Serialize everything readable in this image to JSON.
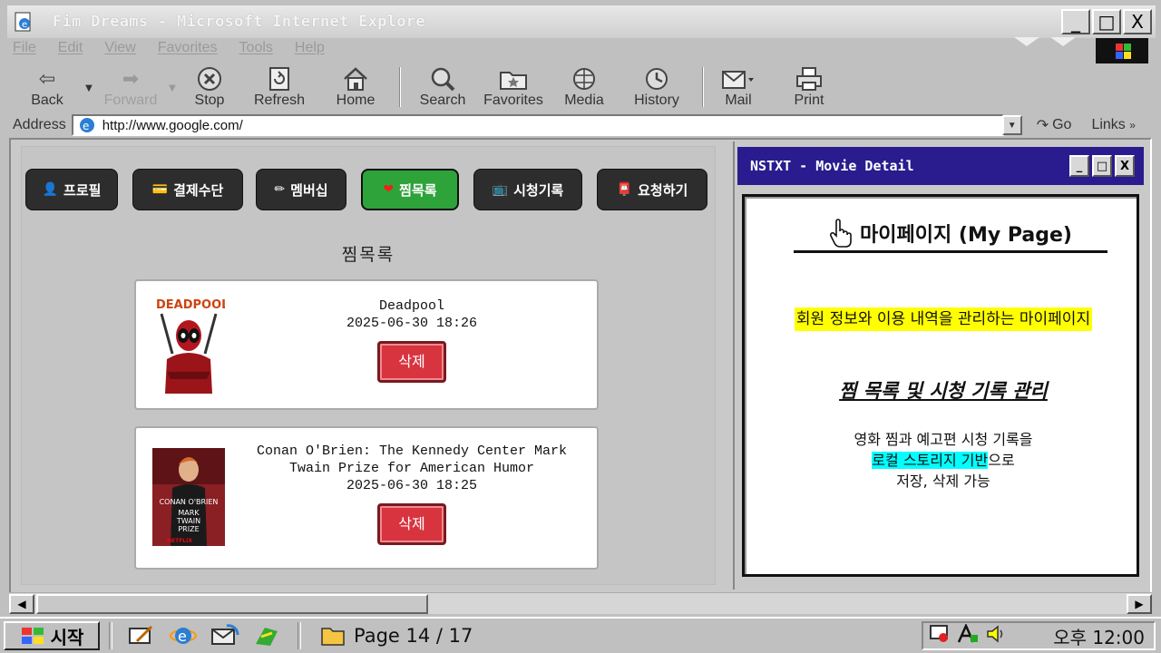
{
  "window": {
    "title": "Fim Dreams - Microsoft Internet Explore",
    "minimize": "_",
    "maximize": "□",
    "close": "X"
  },
  "menu": [
    "File",
    "Edit",
    "View",
    "Favorites",
    "Tools",
    "Help"
  ],
  "toolbar": {
    "back": "Back",
    "forward": "Forward",
    "stop": "Stop",
    "refresh": "Refresh",
    "home": "Home",
    "search": "Search",
    "favorites": "Favorites",
    "media": "Media",
    "history": "History",
    "mail": "Mail",
    "print": "Print"
  },
  "address": {
    "label": "Address",
    "url": "http://www.google.com/",
    "go": "Go",
    "links": "Links"
  },
  "nav": {
    "profile": "프로필",
    "payment": "결제수단",
    "membership": "멤버십",
    "wishlist": "찜목록",
    "history": "시청기록",
    "request": "요청하기"
  },
  "wishlist": {
    "title": "찜목록",
    "items": [
      {
        "name": "Deadpool",
        "date": "2025-06-30 18:26",
        "delete": "삭제"
      },
      {
        "name": "Conan O'Brien: The Kennedy Center Mark Twain Prize for American Humor",
        "date": "2025-06-30 18:25",
        "delete": "삭제"
      }
    ]
  },
  "detail_window": {
    "title": "NSTXT - Movie Detail",
    "minimize": "_",
    "maximize": "□",
    "close": "X",
    "heading": "마이페이지 (My Page)",
    "subtitle": "회원 정보와 이용 내역을 관리하는 마이페이지",
    "feature": "찜 목록 및 시청 기록  관리",
    "desc_line1": "영화 찜과 예고편 시청 기록을",
    "desc_highlight": "로컬 스토리지 기반",
    "desc_line2_rest": "으로",
    "desc_line3": "저장, 삭제 가능"
  },
  "taskbar": {
    "start": "시작",
    "page_indicator": "Page 14 / 17",
    "clock": "오후 12:00"
  },
  "colors": {
    "active_tab": "#2ea33a",
    "delete_button": "#d8343f",
    "detail_titlebar": "#2a1b8e",
    "highlight_yellow": "#ffff00",
    "highlight_cyan": "#00ffff"
  }
}
